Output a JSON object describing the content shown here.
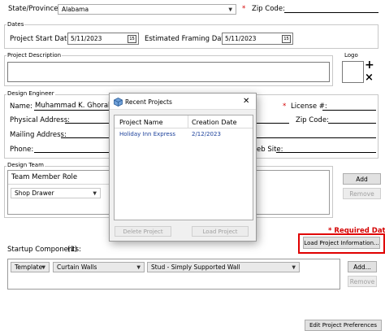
{
  "state": {
    "label": "State/Province:",
    "value": "Alabama",
    "zip_label": "Zip Code:",
    "required_marker": "*"
  },
  "dates": {
    "title": "Dates",
    "start_label": "Project Start Date:",
    "start_value": "5/11/2023",
    "framing_label": "Estimated Framing Date:",
    "framing_value": "5/11/2023",
    "calendar_glyph": "15"
  },
  "project_description": {
    "title": "Project Description"
  },
  "logo": {
    "title": "Logo",
    "add_glyph": "+",
    "remove_glyph": "×"
  },
  "design_engineer": {
    "title": "Design Engineer",
    "name_label": "Name:",
    "name_value": "Muhammad K. Ghoraba",
    "license_label": "License #:",
    "license_marker": "*",
    "physical_label": "Physical Address:",
    "zip_label": "Zip Code:",
    "mailing_label": "Mailing Address:",
    "phone_label": "Phone:",
    "website_label": "eb Site:"
  },
  "design_team": {
    "title": "Design Team",
    "column_header": "Team Member Role",
    "role_value": "Shop Drawer",
    "add_label": "Add",
    "remove_label": "Remove"
  },
  "required_note": "* Required Data",
  "load_project_button": "Load Project Information...",
  "startup": {
    "label": "Startup Components:",
    "count": "(1)",
    "combo1": "Template",
    "combo2": "Curtain Walls",
    "combo3": "Stud - Simply Supported Wall",
    "add_label": "Add...",
    "remove_label": "Remove"
  },
  "edit_preferences_button": "Edit Project Preferences",
  "dialog": {
    "title": "Recent Projects",
    "close_glyph": "✕",
    "columns": [
      "Project Name",
      "Creation Date"
    ],
    "rows": [
      {
        "name": "Holiday Inn Express",
        "date": "2/12/2023"
      }
    ],
    "delete_label": "Delete Project",
    "load_label": "Load Project"
  },
  "colors": {
    "highlight": "#e00000",
    "link": "#1a3f9a"
  }
}
